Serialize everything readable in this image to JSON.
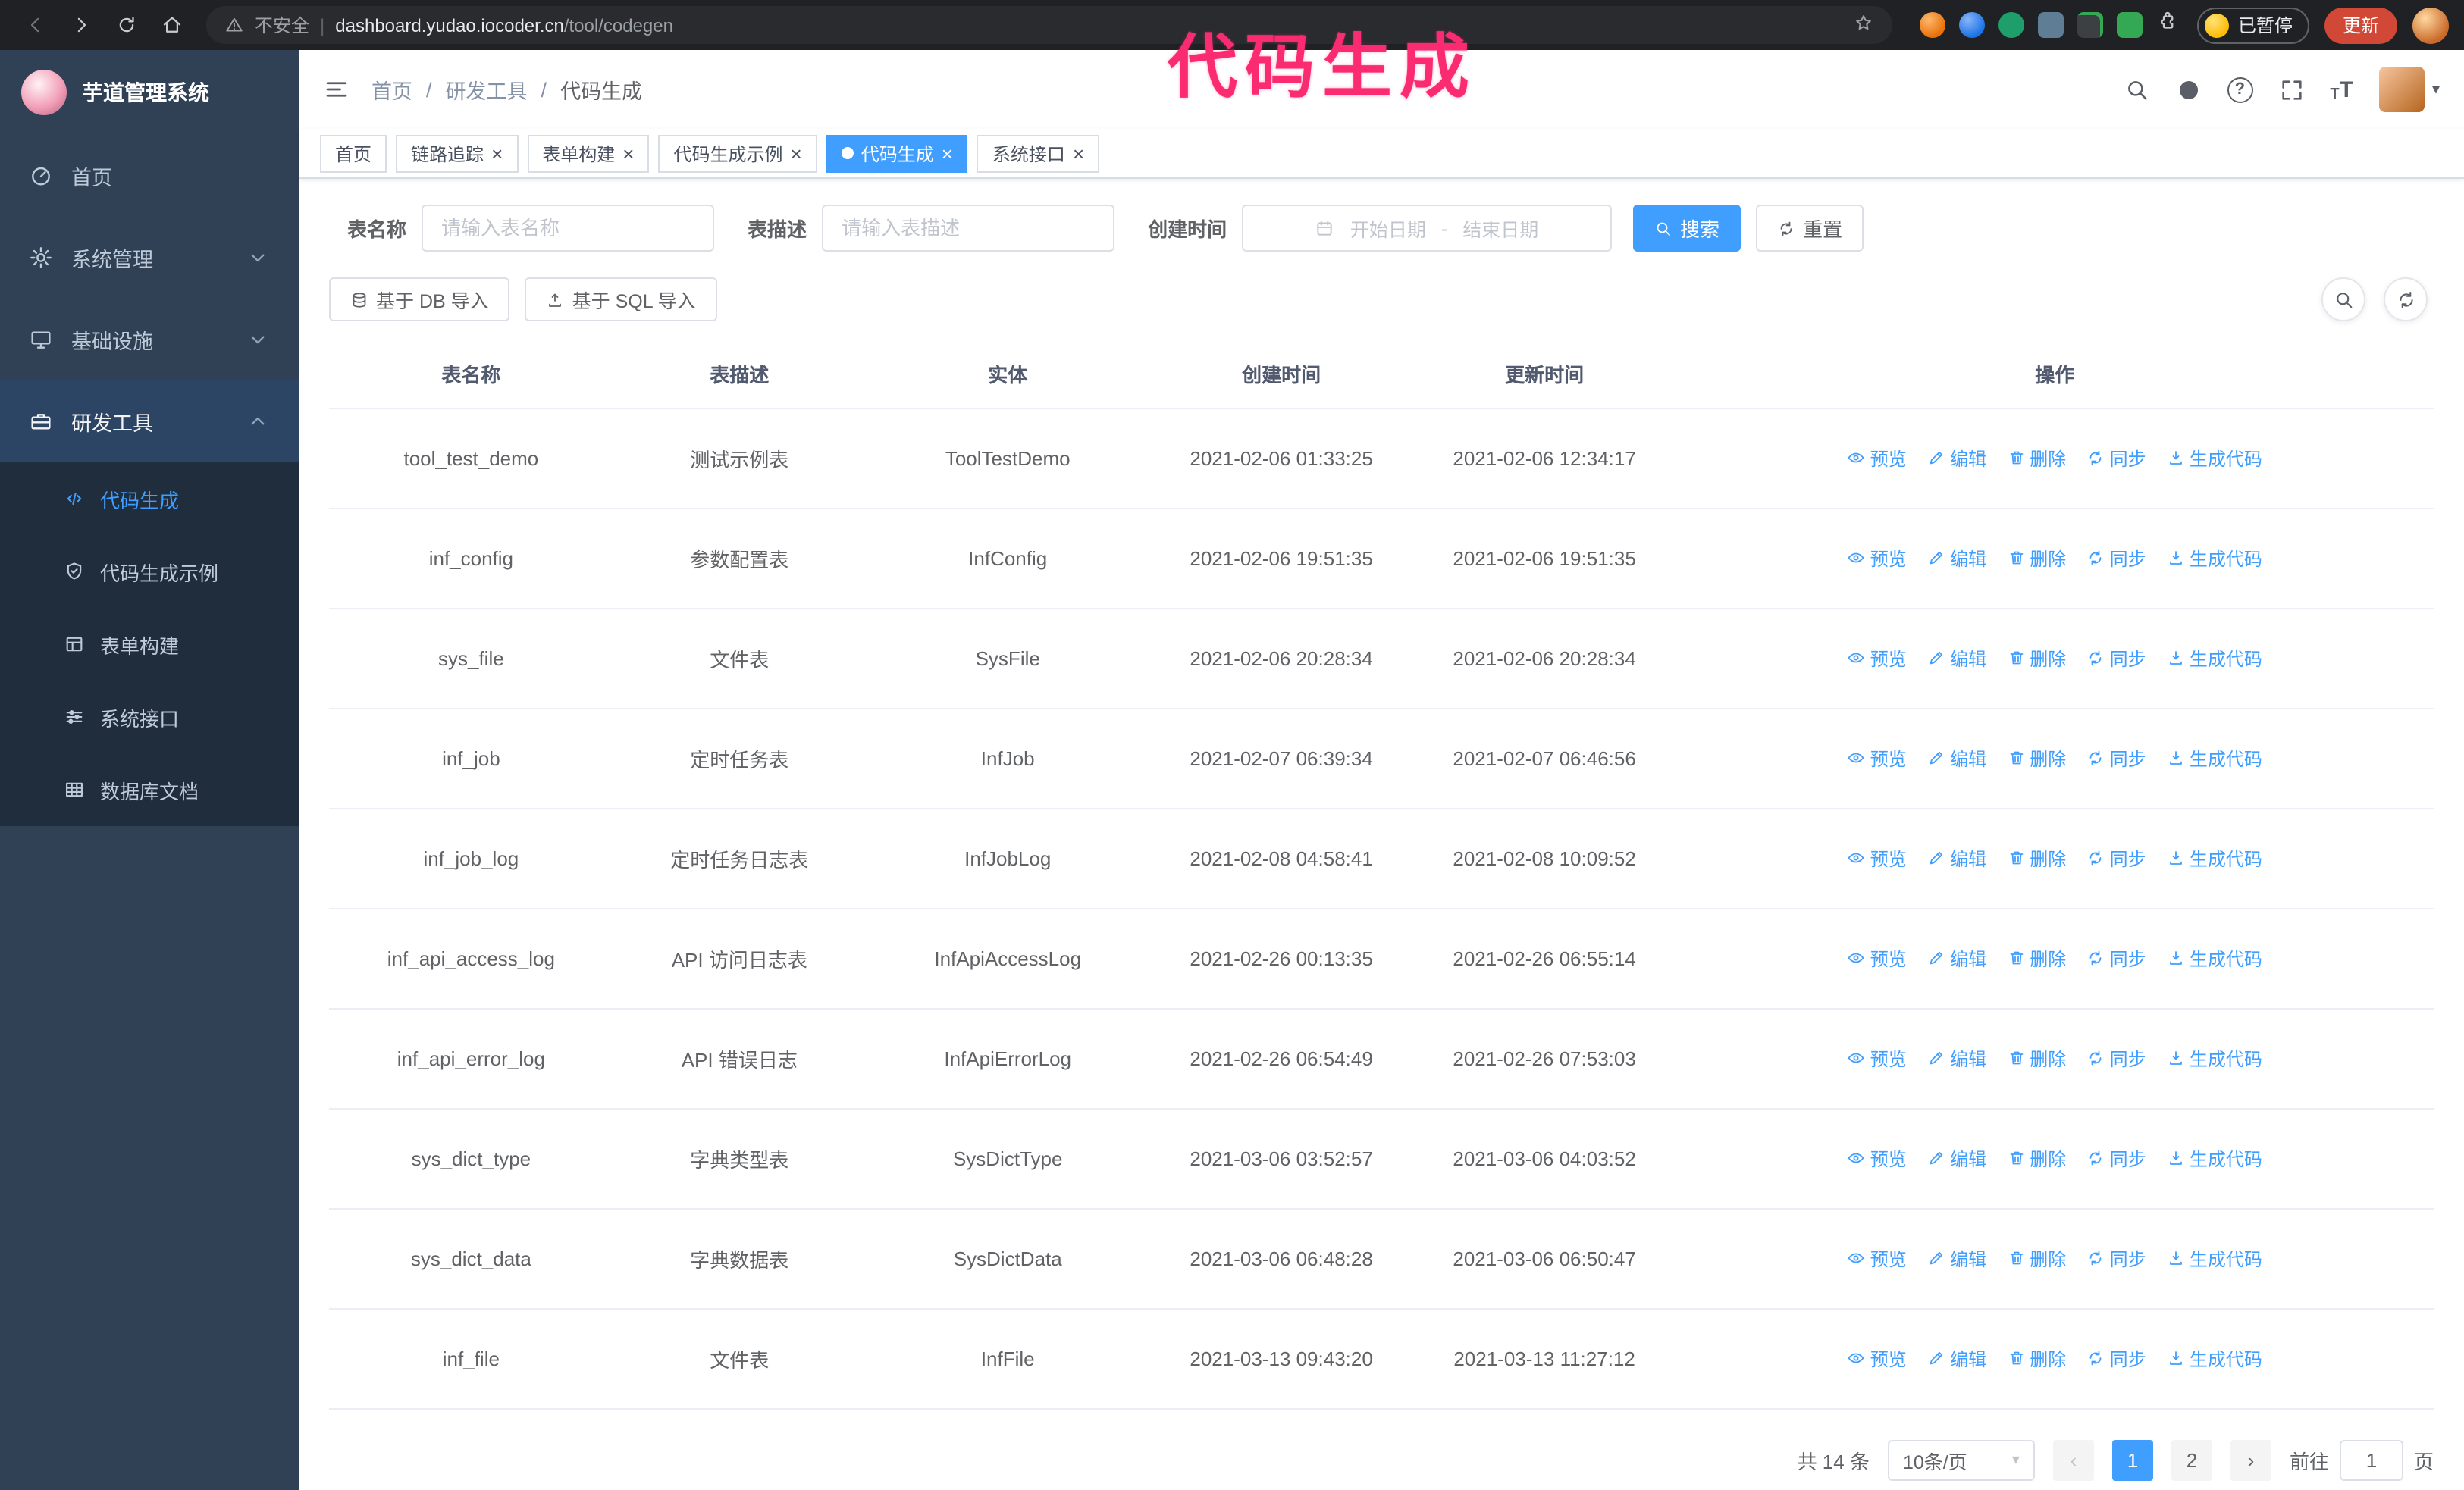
{
  "colors": {
    "accent": "#409eff",
    "sidebar_bg": "#304156",
    "submenu_bg": "#1f2d3d",
    "annotation_pink": "#fb2b71",
    "chrome_bg": "#202124",
    "update_button_red": "#d14836"
  },
  "annotation": {
    "text": "代码生成"
  },
  "browser": {
    "security_label": "不安全",
    "url_domain": "dashboard.yudao.iocoder.cn",
    "url_path": "/tool/codegen",
    "paused_badge": "已暂停",
    "update_button": "更新"
  },
  "sidebar": {
    "logo_title": "芋道管理系统",
    "items": [
      {
        "label": "首页"
      },
      {
        "label": "系统管理"
      },
      {
        "label": "基础设施"
      },
      {
        "label": "研发工具"
      }
    ],
    "submenu": [
      {
        "label": "代码生成"
      },
      {
        "label": "代码生成示例"
      },
      {
        "label": "表单构建"
      },
      {
        "label": "系统接口"
      },
      {
        "label": "数据库文档"
      }
    ]
  },
  "breadcrumb": {
    "separator": "/",
    "items": [
      "首页",
      "研发工具",
      "代码生成"
    ]
  },
  "tabs": [
    {
      "label": "首页",
      "closable": false,
      "active": false
    },
    {
      "label": "链路追踪",
      "closable": true,
      "active": false
    },
    {
      "label": "表单构建",
      "closable": true,
      "active": false
    },
    {
      "label": "代码生成示例",
      "closable": true,
      "active": false
    },
    {
      "label": "代码生成",
      "closable": true,
      "active": true
    },
    {
      "label": "系统接口",
      "closable": true,
      "active": false
    }
  ],
  "filters": {
    "table_name_label": "表名称",
    "table_name_placeholder": "请输入表名称",
    "table_desc_label": "表描述",
    "table_desc_placeholder": "请输入表描述",
    "create_time_label": "创建时间",
    "date_start_placeholder": "开始日期",
    "date_end_placeholder": "结束日期",
    "search_button": "搜索",
    "reset_button": "重置"
  },
  "toolbar": {
    "import_db": "基于 DB 导入",
    "import_sql": "基于 SQL 导入"
  },
  "table": {
    "headers": [
      "表名称",
      "表描述",
      "实体",
      "创建时间",
      "更新时间",
      "操作"
    ],
    "actions": [
      "预览",
      "编辑",
      "删除",
      "同步",
      "生成代码"
    ],
    "rows": [
      {
        "name": "tool_test_demo",
        "desc": "测试示例表",
        "entity": "ToolTestDemo",
        "created": "2021-02-06 01:33:25",
        "updated": "2021-02-06 12:34:17"
      },
      {
        "name": "inf_config",
        "desc": "参数配置表",
        "entity": "InfConfig",
        "created": "2021-02-06 19:51:35",
        "updated": "2021-02-06 19:51:35"
      },
      {
        "name": "sys_file",
        "desc": "文件表",
        "entity": "SysFile",
        "created": "2021-02-06 20:28:34",
        "updated": "2021-02-06 20:28:34"
      },
      {
        "name": "inf_job",
        "desc": "定时任务表",
        "entity": "InfJob",
        "created": "2021-02-07 06:39:34",
        "updated": "2021-02-07 06:46:56"
      },
      {
        "name": "inf_job_log",
        "desc": "定时任务日志表",
        "entity": "InfJobLog",
        "created": "2021-02-08 04:58:41",
        "updated": "2021-02-08 10:09:52"
      },
      {
        "name": "inf_api_access_log",
        "desc": "API 访问日志表",
        "entity": "InfApiAccessLog",
        "created": "2021-02-26 00:13:35",
        "updated": "2021-02-26 06:55:14"
      },
      {
        "name": "inf_api_error_log",
        "desc": "API 错误日志",
        "entity": "InfApiErrorLog",
        "created": "2021-02-26 06:54:49",
        "updated": "2021-02-26 07:53:03"
      },
      {
        "name": "sys_dict_type",
        "desc": "字典类型表",
        "entity": "SysDictType",
        "created": "2021-03-06 03:52:57",
        "updated": "2021-03-06 04:03:52"
      },
      {
        "name": "sys_dict_data",
        "desc": "字典数据表",
        "entity": "SysDictData",
        "created": "2021-03-06 06:48:28",
        "updated": "2021-03-06 06:50:47"
      },
      {
        "name": "inf_file",
        "desc": "文件表",
        "entity": "InfFile",
        "created": "2021-03-13 09:43:20",
        "updated": "2021-03-13 11:27:12"
      }
    ]
  },
  "pagination": {
    "total": "共 14 条",
    "page_size": "10条/页",
    "pages": [
      "1",
      "2"
    ],
    "goto_label": "前往",
    "goto_value": "1",
    "page_unit": "页"
  },
  "icons": {
    "close": "×",
    "caret": "▾",
    "prev": "‹",
    "next": "›",
    "question": "?",
    "font_large": "T",
    "font_small": "T",
    "url_separator": "|",
    "date_separator": "-"
  }
}
